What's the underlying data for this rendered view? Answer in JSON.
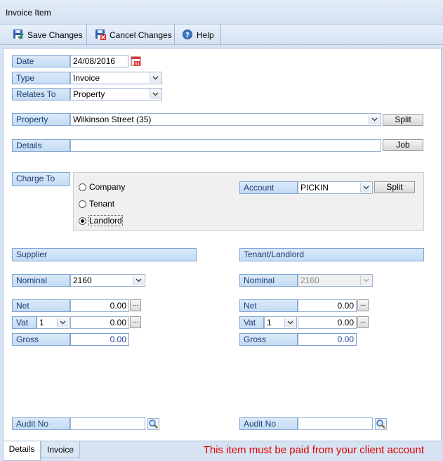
{
  "window": {
    "title": "Invoice Item"
  },
  "toolbar": {
    "save_label": "Save Changes",
    "cancel_label": "Cancel Changes",
    "help_label": "Help"
  },
  "form": {
    "date": {
      "label": "Date",
      "value": "24/08/2016"
    },
    "type": {
      "label": "Type",
      "value": "Invoice"
    },
    "relates_to": {
      "label": "Relates To",
      "value": "Property"
    },
    "property": {
      "label": "Property",
      "value": "Wilkinson Street (35)",
      "split_label": "Split"
    },
    "details": {
      "label": "Details",
      "value": "",
      "job_label": "Job"
    },
    "charge_to": {
      "label": "Charge To",
      "options": [
        "Company",
        "Tenant",
        "Landlord"
      ],
      "selected": "Landlord",
      "account_label": "Account",
      "account_value": "PICKIN",
      "split_label": "Split"
    }
  },
  "supplier": {
    "header": "Supplier",
    "nominal_label": "Nominal",
    "nominal_value": "2160",
    "net_label": "Net",
    "net_value": "0.00",
    "vat_label": "Vat",
    "vat_code": "1",
    "vat_value": "0.00",
    "gross_label": "Gross",
    "gross_value": "0.00",
    "audit_label": "Audit No",
    "audit_value": ""
  },
  "tenant_landlord": {
    "header": "Tenant/Landlord",
    "nominal_label": "Nominal",
    "nominal_value": "2160",
    "net_label": "Net",
    "net_value": "0.00",
    "vat_label": "Vat",
    "vat_code": "1",
    "vat_value": "0.00",
    "gross_label": "Gross",
    "gross_value": "0.00",
    "audit_label": "Audit No",
    "audit_value": ""
  },
  "ellipsis": "...",
  "tabs": [
    "Details",
    "Invoice"
  ],
  "active_tab": "Details",
  "warning": "This item must be paid from your client account",
  "colors": {
    "label_text": "#1b3f73",
    "label_bg": "#c4dcf5",
    "warning": "#e00000",
    "amount_blue": "#1e3fa0"
  },
  "icons": [
    "save-icon",
    "cancel-icon",
    "help-icon",
    "calendar-icon",
    "search-icon",
    "chevron-down-icon"
  ]
}
